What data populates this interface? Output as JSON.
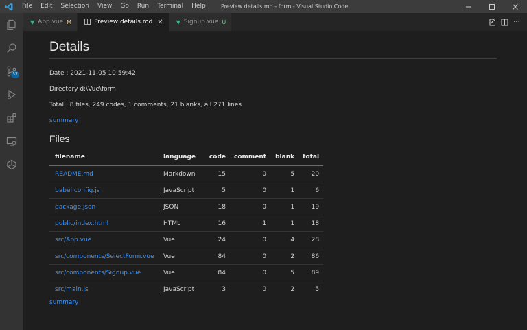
{
  "titlebar": {
    "menu": [
      "File",
      "Edit",
      "Selection",
      "View",
      "Go",
      "Run",
      "Terminal",
      "Help"
    ],
    "window_title": "Preview details.md - form - Visual Studio Code",
    "logo_icon": "vscode-logo-icon"
  },
  "activitybar": {
    "items": [
      {
        "name": "explorer-icon"
      },
      {
        "name": "search-icon"
      },
      {
        "name": "source-control-icon",
        "badge": "37"
      },
      {
        "name": "run-debug-icon"
      },
      {
        "name": "extensions-icon"
      },
      {
        "name": "remote-explorer-icon"
      },
      {
        "name": "docker-icon"
      }
    ],
    "accent": "#0e639c"
  },
  "tabs": [
    {
      "label": "App.vue",
      "status": "M",
      "active": false
    },
    {
      "label": "Preview details.md",
      "status": "",
      "active": true
    },
    {
      "label": "Signup.vue",
      "status": "U",
      "active": false
    }
  ],
  "preview": {
    "title": "Details",
    "date": "Date : 2021-11-05 10:59:42",
    "directory": "Directory d:\\Vue\\form",
    "total": "Total : 8 files, 249 codes, 1 comments, 21 blanks, all 271 lines",
    "summary_link": "summary",
    "files_heading": "Files",
    "table": {
      "headers": [
        "filename",
        "language",
        "code",
        "comment",
        "blank",
        "total"
      ],
      "rows": [
        [
          "README.md",
          "Markdown",
          "15",
          "0",
          "5",
          "20"
        ],
        [
          "babel.config.js",
          "JavaScript",
          "5",
          "0",
          "1",
          "6"
        ],
        [
          "package.json",
          "JSON",
          "18",
          "0",
          "1",
          "19"
        ],
        [
          "public/index.html",
          "HTML",
          "16",
          "1",
          "1",
          "18"
        ],
        [
          "src/App.vue",
          "Vue",
          "24",
          "0",
          "4",
          "28"
        ],
        [
          "src/components/SelectForm.vue",
          "Vue",
          "84",
          "0",
          "2",
          "86"
        ],
        [
          "src/components/Signup.vue",
          "Vue",
          "84",
          "0",
          "5",
          "89"
        ],
        [
          "src/main.js",
          "JavaScript",
          "3",
          "0",
          "2",
          "5"
        ]
      ]
    },
    "summary_link_bottom": "summary"
  },
  "colors": {
    "link": "#3794ff",
    "background": "#1e1e1e",
    "vue_icon": "#41b883"
  }
}
